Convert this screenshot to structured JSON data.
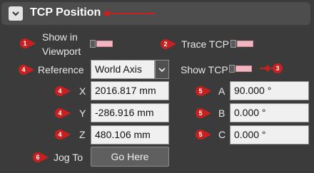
{
  "header": {
    "title": "TCP Position"
  },
  "show_in_viewport": {
    "label_line1": "Show in",
    "label_line2": "Viewport",
    "badge": "1"
  },
  "trace_tcp": {
    "label": "Trace TCP",
    "badge": "2"
  },
  "show_tcp": {
    "label": "Show TCP",
    "badge": "3"
  },
  "reference": {
    "label": "Reference",
    "value": "World Axis",
    "badge": "4"
  },
  "position": [
    {
      "axis": "X",
      "value": "2016.817 mm",
      "badge": "4"
    },
    {
      "axis": "Y",
      "value": "-286.916 mm",
      "badge": "4"
    },
    {
      "axis": "Z",
      "value": "480.106 mm",
      "badge": "4"
    }
  ],
  "orientation": [
    {
      "axis": "A",
      "value": "90.000 °",
      "badge": "5"
    },
    {
      "axis": "B",
      "value": "0.000 °",
      "badge": "5"
    },
    {
      "axis": "C",
      "value": "0.000 °",
      "badge": "5"
    }
  ],
  "jog_to": {
    "label": "Jog To",
    "button_label": "Go Here",
    "badge": "6"
  },
  "colors": {
    "annotation": "#c8201f",
    "toggle_on": "#f3b6c1",
    "header_bg": "#4d4d4d"
  },
  "icons": {
    "collapse": "chevron-down-icon",
    "dropdown": "chevron-down-icon"
  }
}
